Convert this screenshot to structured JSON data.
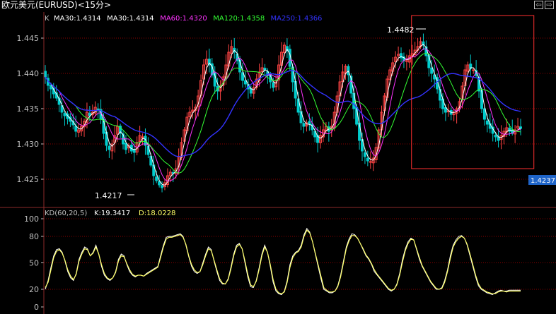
{
  "window": {
    "title": "欧元美元(EURUSD)<15分>",
    "prev_icon": "arrow-left-icon",
    "next_icon": "arrow-right-icon",
    "prev_glyph": "⇦",
    "next_glyph": "⇨"
  },
  "main_legend": {
    "k_label": "K",
    "items": [
      {
        "text": "MA30:1.4314",
        "color": "#ffffff"
      },
      {
        "text": "MA30:1.4314",
        "color": "#ffffff"
      },
      {
        "text": "MA60:1.4320",
        "color": "#ff33ff"
      },
      {
        "text": "MA120:1.4358",
        "color": "#33ff33"
      },
      {
        "text": "MA250:1.4366",
        "color": "#3333ff"
      }
    ]
  },
  "sub_legend": {
    "indicator": "KD(60,20,5)",
    "k_text": "K:19.3417",
    "d_text": "D:18.0228"
  },
  "annotations": {
    "low_label": "1.4217",
    "high_label": "1.4482",
    "current_price": "1.4237"
  },
  "colors": {
    "background": "#000000",
    "grid": "#8b0000",
    "axis_text": "#c0c0c0",
    "candle_up": "#ff4444",
    "candle_down": "#00cccc",
    "ma30": "#ffffff",
    "ma60": "#ff33ff",
    "ma120": "#33ff33",
    "ma250": "#3333ff",
    "kd_k": "#ffffff",
    "kd_d": "#ffff66",
    "price_tag_bg": "#1e64c8",
    "selection_box": "#ff3030"
  },
  "chart_data": [
    {
      "type": "candlestick",
      "title": "欧元美元(EURUSD)<15分>",
      "yticks": [
        "1.445",
        "1.440",
        "1.435",
        "1.430",
        "1.425"
      ],
      "ylim": [
        1.4212,
        1.4502
      ],
      "low_marker": 1.4217,
      "high_marker": 1.4482,
      "last_price": 1.4237,
      "selection_range": {
        "start_index": 132,
        "end_index": 175
      },
      "close": [
        1.4395,
        1.4383,
        1.4378,
        1.4371,
        1.4365,
        1.4356,
        1.4345,
        1.434,
        1.4336,
        1.4332,
        1.4327,
        1.4318,
        1.432,
        1.4325,
        1.4332,
        1.4345,
        1.434,
        1.4345,
        1.4352,
        1.4348,
        1.4335,
        1.4315,
        1.4298,
        1.4292,
        1.43,
        1.4312,
        1.4325,
        1.4315,
        1.43,
        1.4292,
        1.4298,
        1.429,
        1.4288,
        1.4302,
        1.4312,
        1.431,
        1.4298,
        1.4285,
        1.427,
        1.4255,
        1.4248,
        1.4242,
        1.4238,
        1.4245,
        1.4255,
        1.426,
        1.4258,
        1.4265,
        1.4282,
        1.4302,
        1.432,
        1.4338,
        1.4345,
        1.4348,
        1.4352,
        1.4368,
        1.439,
        1.4412,
        1.442,
        1.4412,
        1.4398,
        1.4382,
        1.4375,
        1.4382,
        1.4395,
        1.4412,
        1.443,
        1.4438,
        1.443,
        1.4418,
        1.4402,
        1.439,
        1.4385,
        1.4378,
        1.4372,
        1.438,
        1.4392,
        1.4402,
        1.4408,
        1.4405,
        1.4397,
        1.4388,
        1.438,
        1.439,
        1.4412,
        1.443,
        1.444,
        1.4432,
        1.441,
        1.4388,
        1.4365,
        1.4345,
        1.433,
        1.4325,
        1.433,
        1.4328,
        1.432,
        1.431,
        1.4302,
        1.4312,
        1.432,
        1.4325,
        1.4318,
        1.4325,
        1.4345,
        1.4368,
        1.4388,
        1.4402,
        1.441,
        1.4398,
        1.4372,
        1.435,
        1.4328,
        1.4305,
        1.429,
        1.4282,
        1.4276,
        1.4275,
        1.428,
        1.4295,
        1.432,
        1.4345,
        1.4368,
        1.4392,
        1.4405,
        1.4415,
        1.4423,
        1.4427,
        1.4422,
        1.4418,
        1.4418,
        1.4425,
        1.4428,
        1.4433,
        1.4438,
        1.4445,
        1.444,
        1.4425,
        1.4408,
        1.44,
        1.4392,
        1.4378,
        1.4362,
        1.435,
        1.4345,
        1.4347,
        1.4342,
        1.4345,
        1.435,
        1.436,
        1.4382,
        1.4405,
        1.4412,
        1.4407,
        1.4405,
        1.4397,
        1.4375,
        1.435,
        1.4335,
        1.4328,
        1.4322,
        1.4315,
        1.431,
        1.4305,
        1.4312,
        1.4318,
        1.4323,
        1.4318,
        1.4315,
        1.432,
        1.4325,
        1.4322
      ]
    },
    {
      "type": "line",
      "title": "KD(60,20,5)",
      "yticks": [
        "100",
        "80",
        "50",
        "20",
        "0"
      ],
      "ylim": [
        0,
        100
      ],
      "series": [
        {
          "name": "K",
          "values": [
            20,
            30,
            45,
            58,
            65,
            66,
            62,
            52,
            40,
            33,
            30,
            38,
            54,
            62,
            68,
            66,
            58,
            62,
            70,
            60,
            46,
            36,
            32,
            30,
            33,
            40,
            54,
            60,
            58,
            48,
            40,
            36,
            34,
            36,
            36,
            35,
            38,
            40,
            42,
            44,
            46,
            58,
            70,
            79,
            80,
            80,
            81,
            82,
            83,
            80,
            70,
            57,
            46,
            40,
            38,
            40,
            50,
            60,
            68,
            65,
            52,
            40,
            30,
            26,
            26,
            32,
            45,
            60,
            70,
            72,
            66,
            50,
            34,
            23,
            22,
            30,
            44,
            60,
            70,
            62,
            46,
            28,
            18,
            15,
            14,
            18,
            30,
            48,
            58,
            62,
            64,
            70,
            82,
            89,
            85,
            74,
            60,
            46,
            32,
            20,
            18,
            16,
            16,
            18,
            24,
            36,
            52,
            68,
            77,
            83,
            82,
            78,
            72,
            65,
            58,
            54,
            48,
            40,
            36,
            32,
            28,
            24,
            20,
            18,
            20,
            26,
            38,
            54,
            66,
            74,
            78,
            76,
            65,
            54,
            46,
            40,
            34,
            28,
            24,
            20,
            20,
            22,
            30,
            42,
            58,
            70,
            76,
            80,
            81,
            78,
            70,
            58,
            46,
            34,
            24,
            20,
            18,
            16,
            15,
            14,
            16,
            18,
            19,
            18,
            18,
            19,
            19,
            19,
            19,
            19
          ]
        },
        {
          "name": "D",
          "values": [
            22,
            28,
            42,
            56,
            63,
            65,
            61,
            53,
            42,
            35,
            31,
            37,
            52,
            60,
            66,
            65,
            58,
            61,
            68,
            60,
            48,
            38,
            33,
            31,
            33,
            39,
            52,
            58,
            57,
            49,
            42,
            37,
            35,
            36,
            36,
            35,
            37,
            39,
            41,
            43,
            45,
            56,
            68,
            77,
            79,
            79,
            80,
            81,
            82,
            79,
            71,
            58,
            48,
            42,
            39,
            40,
            48,
            58,
            66,
            64,
            53,
            42,
            32,
            27,
            26,
            31,
            43,
            58,
            68,
            71,
            66,
            52,
            37,
            25,
            23,
            29,
            42,
            58,
            68,
            62,
            48,
            31,
            20,
            16,
            15,
            17,
            28,
            45,
            56,
            61,
            63,
            68,
            80,
            87,
            84,
            74,
            61,
            48,
            35,
            22,
            19,
            17,
            17,
            18,
            23,
            34,
            50,
            66,
            75,
            81,
            81,
            78,
            72,
            66,
            59,
            55,
            49,
            42,
            37,
            33,
            29,
            25,
            21,
            19,
            20,
            25,
            36,
            51,
            64,
            72,
            77,
            76,
            66,
            56,
            47,
            41,
            35,
            29,
            25,
            21,
            20,
            21,
            28,
            40,
            55,
            68,
            74,
            78,
            80,
            78,
            71,
            60,
            48,
            36,
            26,
            21,
            19,
            17,
            16,
            15,
            15,
            17,
            18,
            18,
            17,
            18,
            18,
            18,
            18,
            18
          ]
        }
      ]
    }
  ]
}
